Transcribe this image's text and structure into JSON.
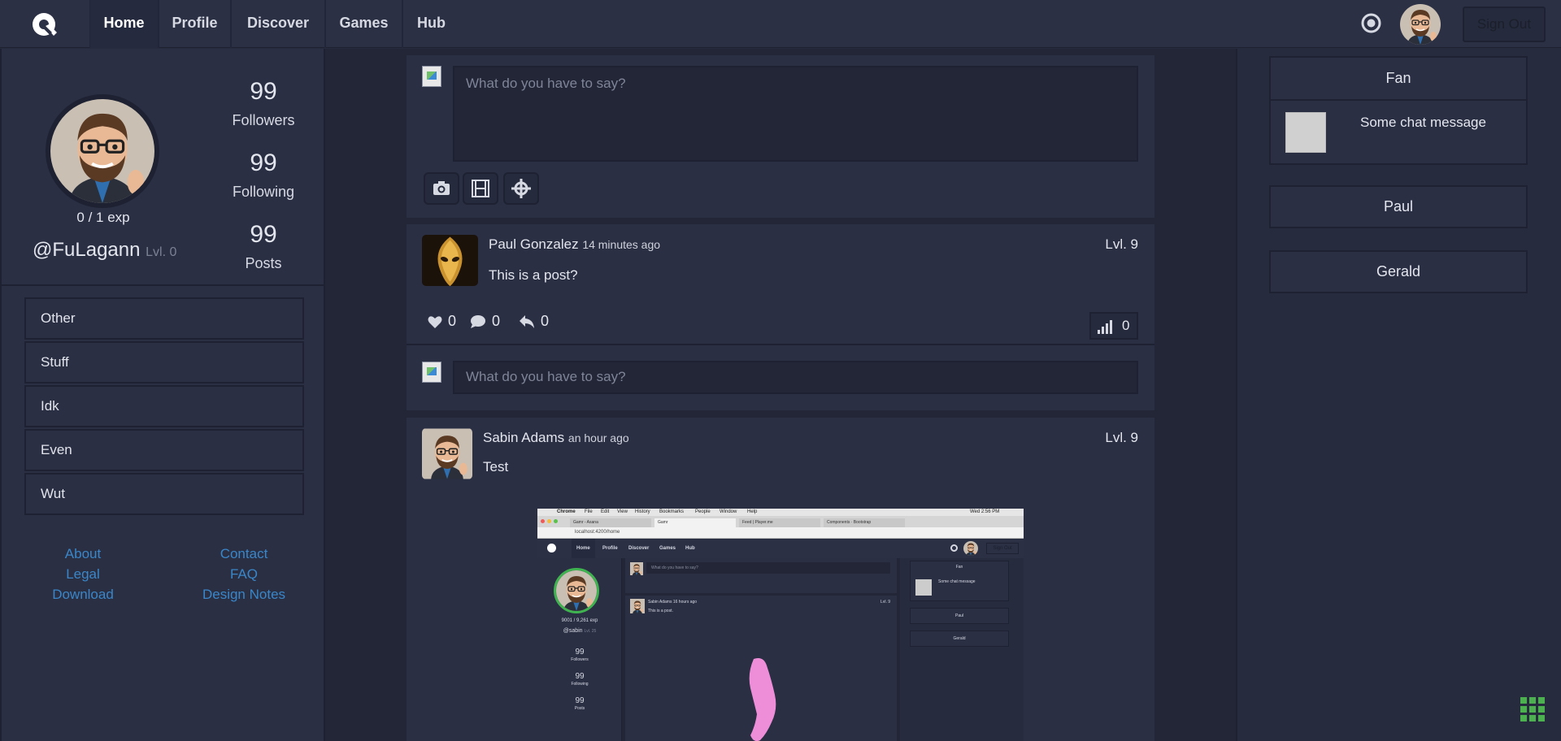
{
  "nav": {
    "items": [
      "Home",
      "Profile",
      "Discover",
      "Games",
      "Hub"
    ],
    "sign_out": "Sign Out"
  },
  "profile": {
    "exp": "0 / 1 exp",
    "username": "@FuLagann",
    "level": "Lvl. 0",
    "followers_count": "99",
    "followers_label": "Followers",
    "following_count": "99",
    "following_label": "Following",
    "posts_count": "99",
    "posts_label": "Posts"
  },
  "menu": [
    "Other",
    "Stuff",
    "Idk",
    "Even",
    "Wut"
  ],
  "footer_links": {
    "about": "About",
    "contact": "Contact",
    "legal": "Legal",
    "faq": "FAQ",
    "download": "Download",
    "design_notes": "Design Notes"
  },
  "composer": {
    "placeholder": "What do you have to say?"
  },
  "posts": [
    {
      "author": "Paul Gonzalez",
      "time": "14 minutes ago",
      "level": "Lvl. 9",
      "text": "This is a post?",
      "likes": "0",
      "comments": "0",
      "shares": "0",
      "views": "0",
      "reply_placeholder": "What do you have to say?"
    },
    {
      "author": "Sabin Adams",
      "time": "an hour ago",
      "level": "Lvl. 9",
      "text": "Test"
    }
  ],
  "chats": [
    {
      "name": "Fan",
      "message": "Some chat message"
    },
    {
      "name": "Paul"
    },
    {
      "name": "Gerald"
    }
  ],
  "embedded_screenshot": {
    "menu_bar": [
      "Chrome",
      "File",
      "Edit",
      "View",
      "History",
      "Bookmarks",
      "People",
      "Window",
      "Help"
    ],
    "clock": "Wed 2:56 PM",
    "tabs": [
      "Gamr - Asana",
      "Gamr",
      "Feed | Player.me",
      "Components · Bootstrap"
    ],
    "url": "localhost:4200/home",
    "nav_items": [
      "Home",
      "Profile",
      "Discover",
      "Games",
      "Hub"
    ],
    "sign_out": "Sign Out",
    "exp": "9001 / 9,261 exp",
    "username": "@sabin",
    "level": "Lvl. 25",
    "followers_count": "99",
    "followers_label": "Followers",
    "following_count": "99",
    "following_label": "Following",
    "posts_count": "99",
    "posts_label": "Posts",
    "composer_placeholder": "What do you have to say?",
    "post_author": "Sabin Adams",
    "post_time": "16 hours ago",
    "post_level": "Lvl. 9",
    "post_text": "This is a post.",
    "chat_names": [
      "Fan",
      "Paul",
      "Gerald"
    ],
    "chat_message": "Some chat message"
  },
  "colors": {
    "accent_link": "#3a86c8",
    "panel": "#2a2f44",
    "background": "#222637"
  }
}
